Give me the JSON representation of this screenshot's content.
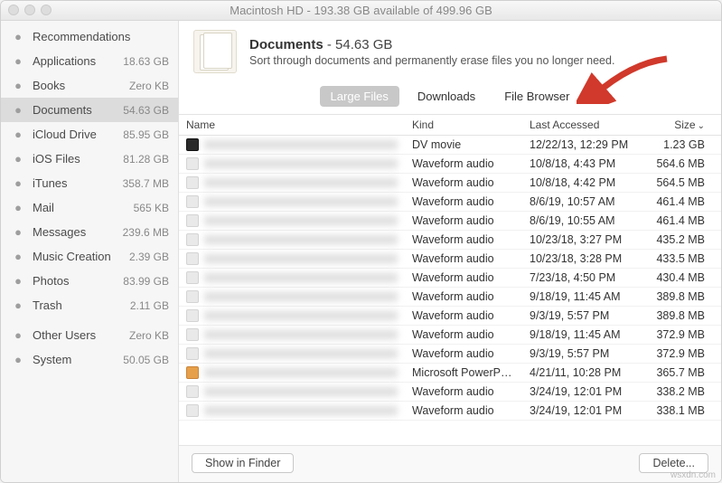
{
  "window": {
    "title": "Macintosh HD - 193.38 GB available of 499.96 GB"
  },
  "sidebar": {
    "items": [
      {
        "icon": "lightbulb-icon",
        "label": "Recommendations",
        "size": ""
      },
      {
        "icon": "apps-icon",
        "label": "Applications",
        "size": "18.63 GB"
      },
      {
        "icon": "books-icon",
        "label": "Books",
        "size": "Zero KB"
      },
      {
        "icon": "documents-icon",
        "label": "Documents",
        "size": "54.63 GB",
        "selected": true
      },
      {
        "icon": "icloud-icon",
        "label": "iCloud Drive",
        "size": "85.95 GB"
      },
      {
        "icon": "ios-icon",
        "label": "iOS Files",
        "size": "81.28 GB"
      },
      {
        "icon": "itunes-icon",
        "label": "iTunes",
        "size": "358.7 MB"
      },
      {
        "icon": "mail-icon",
        "label": "Mail",
        "size": "565 KB"
      },
      {
        "icon": "messages-icon",
        "label": "Messages",
        "size": "239.6 MB"
      },
      {
        "icon": "music-icon",
        "label": "Music Creation",
        "size": "2.39 GB"
      },
      {
        "icon": "photos-icon",
        "label": "Photos",
        "size": "83.99 GB"
      },
      {
        "icon": "trash-icon",
        "label": "Trash",
        "size": "2.11 GB"
      },
      {
        "sep": true
      },
      {
        "icon": "users-icon",
        "label": "Other Users",
        "size": "Zero KB"
      },
      {
        "icon": "system-icon",
        "label": "System",
        "size": "50.05 GB"
      }
    ]
  },
  "header": {
    "title": "Documents",
    "size": "54.63 GB",
    "subtitle": "Sort through documents and permanently erase files you no longer need."
  },
  "tabs": [
    {
      "label": "Large Files",
      "active": true
    },
    {
      "label": "Downloads"
    },
    {
      "label": "File Browser"
    }
  ],
  "columns": {
    "name": "Name",
    "kind": "Kind",
    "date": "Last Accessed",
    "size": "Size"
  },
  "rows": [
    {
      "icon": "dark",
      "kind": "DV movie",
      "date": "12/22/13, 12:29 PM",
      "size": "1.23 GB"
    },
    {
      "icon": "",
      "kind": "Waveform audio",
      "date": "10/8/18, 4:43 PM",
      "size": "564.6 MB"
    },
    {
      "icon": "",
      "kind": "Waveform audio",
      "date": "10/8/18, 4:42 PM",
      "size": "564.5 MB"
    },
    {
      "icon": "",
      "kind": "Waveform audio",
      "date": "8/6/19, 10:57 AM",
      "size": "461.4 MB"
    },
    {
      "icon": "",
      "kind": "Waveform audio",
      "date": "8/6/19, 10:55 AM",
      "size": "461.4 MB"
    },
    {
      "icon": "",
      "kind": "Waveform audio",
      "date": "10/23/18, 3:27 PM",
      "size": "435.2 MB"
    },
    {
      "icon": "",
      "kind": "Waveform audio",
      "date": "10/23/18, 3:28 PM",
      "size": "433.5 MB"
    },
    {
      "icon": "",
      "kind": "Waveform audio",
      "date": "7/23/18, 4:50 PM",
      "size": "430.4 MB"
    },
    {
      "icon": "",
      "kind": "Waveform audio",
      "date": "9/18/19, 11:45 AM",
      "size": "389.8 MB"
    },
    {
      "icon": "",
      "kind": "Waveform audio",
      "date": "9/3/19, 5:57 PM",
      "size": "389.8 MB"
    },
    {
      "icon": "",
      "kind": "Waveform audio",
      "date": "9/18/19, 11:45 AM",
      "size": "372.9 MB"
    },
    {
      "icon": "",
      "kind": "Waveform audio",
      "date": "9/3/19, 5:57 PM",
      "size": "372.9 MB"
    },
    {
      "icon": "ppt",
      "kind": "Microsoft PowerP…",
      "date": "4/21/11, 10:28 PM",
      "size": "365.7 MB"
    },
    {
      "icon": "",
      "kind": "Waveform audio",
      "date": "3/24/19, 12:01 PM",
      "size": "338.2 MB"
    },
    {
      "icon": "",
      "kind": "Waveform audio",
      "date": "3/24/19, 12:01 PM",
      "size": "338.1 MB"
    }
  ],
  "footer": {
    "show": "Show in Finder",
    "delete": "Delete..."
  },
  "watermark": "wsxdn.com"
}
